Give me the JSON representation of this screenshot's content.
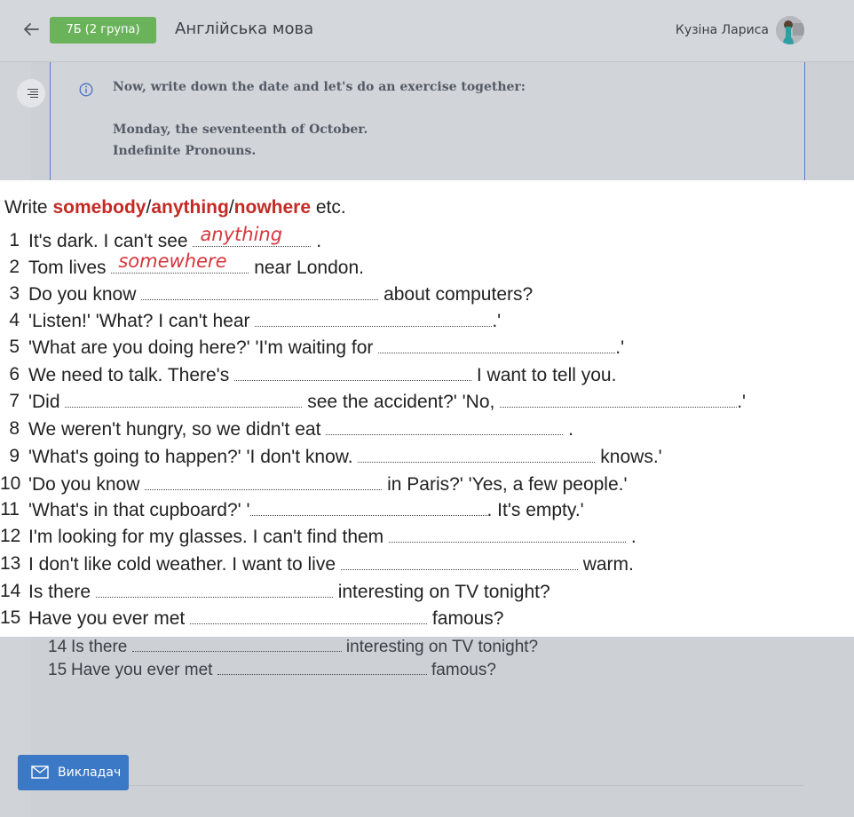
{
  "header": {
    "back_icon": "arrow-left-icon",
    "group_badge": "7Б (2 група)",
    "subject": "Англійська мова",
    "user_name": "Кузіна Лариса"
  },
  "note": {
    "icon": "info-icon",
    "line1": "Now, write down the date and let's do an exercise together:",
    "line2": "Monday, the seventeenth of October.",
    "line3": "Indefinite Pronouns."
  },
  "exercise": {
    "title_prefix": "Write ",
    "kw1": "somebody",
    "slash1": "/",
    "kw2": "anything",
    "slash2": "/",
    "kw3": "nowhere",
    "title_suffix": " etc.",
    "items": [
      {
        "n": "1",
        "before": "It's dark.  I can't see ",
        "answer": "anything",
        "after": " ."
      },
      {
        "n": "2",
        "before": "Tom lives ",
        "answer": "somewhere",
        "after": " near London."
      },
      {
        "n": "3",
        "before": "Do you know ",
        "answer": "",
        "after": " about computers?"
      },
      {
        "n": "4",
        "before": "'Listen!'     'What?  I can't hear ",
        "answer": "",
        "after": ".'"
      },
      {
        "n": "5",
        "before": "'What are you doing here?'     'I'm waiting for ",
        "answer": "",
        "after": ".'"
      },
      {
        "n": "6",
        "before": "We need to talk.  There's ",
        "answer": "",
        "after": " I want to tell you."
      },
      {
        "n": "7",
        "before": "'Did ",
        "answer": "",
        "after": " see the accident?'     'No, ",
        "tail": ".'"
      },
      {
        "n": "8",
        "before": "We weren't hungry, so we didn't eat ",
        "answer": "",
        "after": " ."
      },
      {
        "n": "9",
        "before": "'What's going to happen?'     'I don't know.   ",
        "answer": "",
        "after": " knows.'"
      },
      {
        "n": "10",
        "before": "'Do you know ",
        "answer": "",
        "after": " in Paris?'     'Yes, a few people.'"
      },
      {
        "n": "11",
        "before": "'What's in that cupboard?'     '",
        "answer": "",
        "after": ".  It's empty.'"
      },
      {
        "n": "12",
        "before": "I'm looking for my glasses.  I can't find them ",
        "answer": "",
        "after": " ."
      },
      {
        "n": "13",
        "before": "I don't like cold weather.  I want to live ",
        "answer": "",
        "after": " warm."
      },
      {
        "n": "14",
        "before": "Is there ",
        "answer": "",
        "after": " interesting on TV tonight?"
      },
      {
        "n": "15",
        "before": "Have you ever met ",
        "answer": "",
        "after": " famous?"
      }
    ]
  },
  "underlying": [
    {
      "n": "14",
      "before": "Is there ",
      "after": " interesting on TV tonight?"
    },
    {
      "n": "15",
      "before": "Have you ever met ",
      "after": " famous?"
    }
  ],
  "teacher_button": {
    "icon": "mail-icon",
    "label": "Викладач"
  },
  "colors": {
    "accent": "#3b78c5",
    "badge": "#6bb35a",
    "keyword": "#c42a24",
    "handwriting": "#d6363c"
  }
}
